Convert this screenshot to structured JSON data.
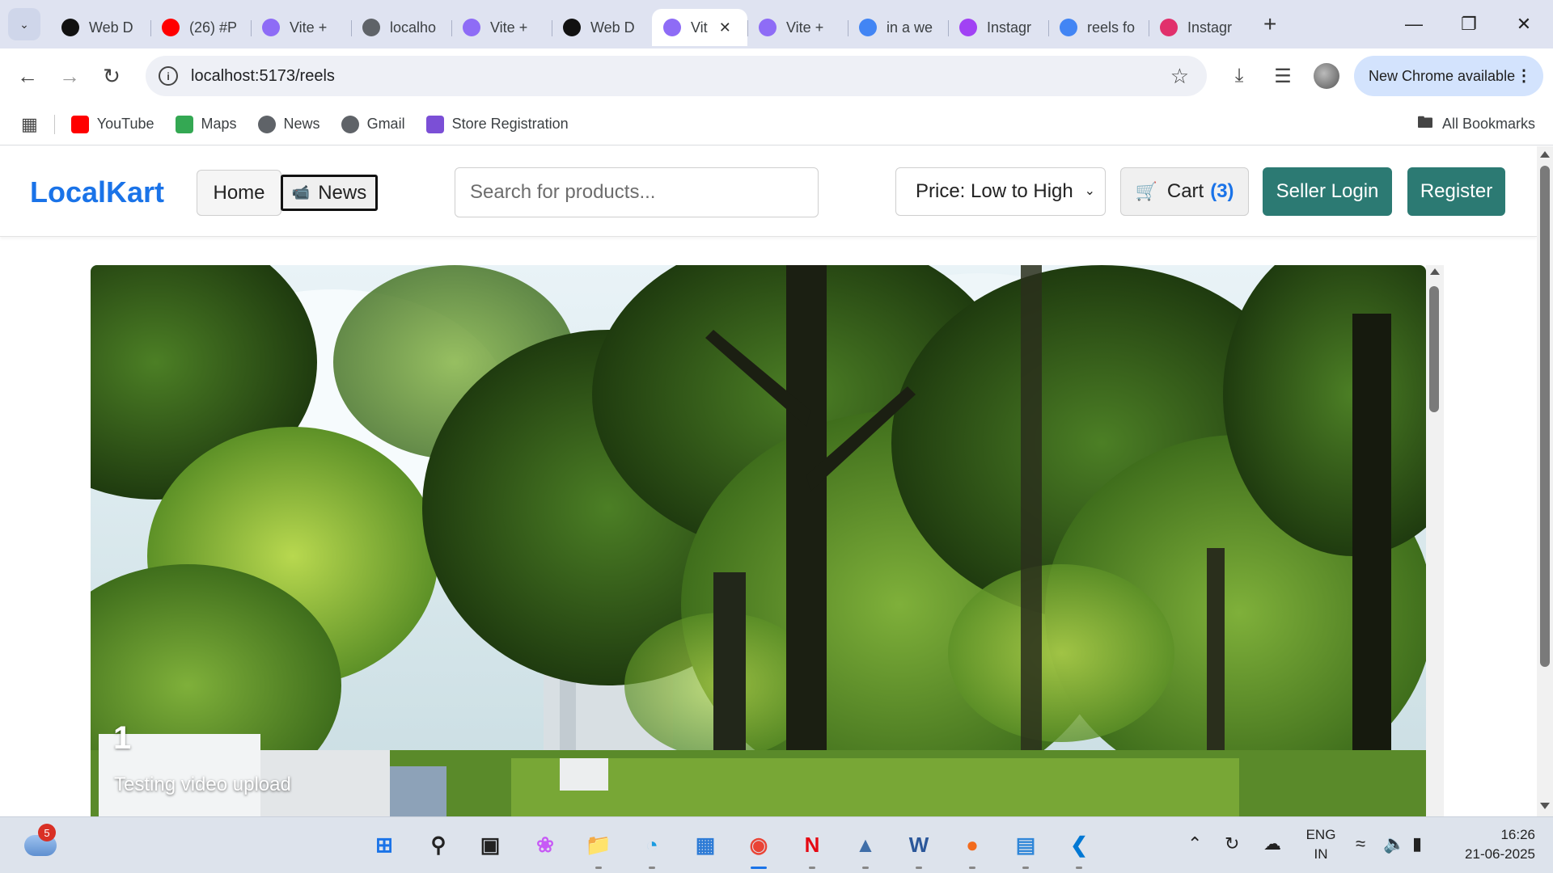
{
  "browser": {
    "tabs": [
      {
        "title": "Web D",
        "favicon": "openai-icon",
        "color": "#111111"
      },
      {
        "title": "(26) #P",
        "favicon": "youtube-icon",
        "color": "#ff0000"
      },
      {
        "title": "Vite + ",
        "favicon": "vite-icon",
        "color": "#8e6cf6"
      },
      {
        "title": "localho",
        "favicon": "globe-icon",
        "color": "#5f6368"
      },
      {
        "title": "Vite + ",
        "favicon": "vite-icon",
        "color": "#8e6cf6"
      },
      {
        "title": "Web D",
        "favicon": "openai-icon",
        "color": "#111111"
      },
      {
        "title": "Vit",
        "favicon": "vite-icon",
        "color": "#8e6cf6",
        "active": true
      },
      {
        "title": "Vite + ",
        "favicon": "vite-icon",
        "color": "#8e6cf6"
      },
      {
        "title": "in a we",
        "favicon": "google-icon",
        "color": "#4285f4"
      },
      {
        "title": "Instagr",
        "favicon": "sss-icon",
        "color": "#a142f4"
      },
      {
        "title": "reels fo",
        "favicon": "google-icon",
        "color": "#4285f4"
      },
      {
        "title": "Instagr",
        "favicon": "instagram-icon",
        "color": "#e1306c"
      }
    ],
    "url": "localhost:5173/reels",
    "update_chip": "New Chrome available",
    "bookmarks": [
      {
        "label": "YouTube",
        "icon": "youtube-icon",
        "color": "#ff0000"
      },
      {
        "label": "Maps",
        "icon": "maps-icon",
        "color": "#34a853"
      },
      {
        "label": "News",
        "icon": "globe-icon",
        "color": "#5f6368"
      },
      {
        "label": "Gmail",
        "icon": "globe-icon",
        "color": "#5f6368"
      },
      {
        "label": "Store Registration",
        "icon": "sliders-icon",
        "color": "#7b4fd6"
      }
    ],
    "all_bookmarks": "All Bookmarks"
  },
  "app": {
    "brand": "LocalKart",
    "nav_home": "Home",
    "nav_news": "News",
    "search_placeholder": "Search for products...",
    "sort_selected": "Price: Low to High",
    "cart_label": "Cart",
    "cart_count": "(3)",
    "seller_login": "Seller Login",
    "register": "Register",
    "accent_color": "#1a73e8",
    "button_color": "#2c7a73"
  },
  "reel": {
    "number": "1",
    "caption": "Testing video upload"
  },
  "taskbar": {
    "notification_badge": "5",
    "language_top": "ENG",
    "language_bottom": "IN",
    "time": "16:26",
    "date": "21-06-2025"
  }
}
